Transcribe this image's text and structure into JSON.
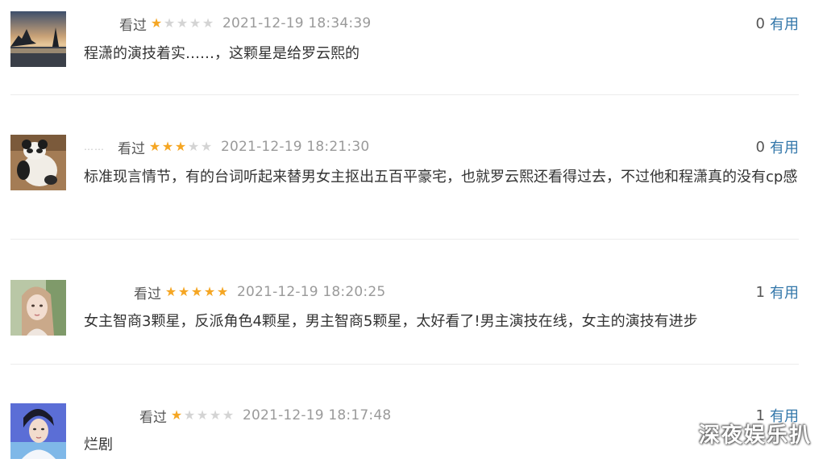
{
  "reviews": [
    {
      "username": "",
      "status": "看过",
      "rating": 1,
      "time": "2021-12-19 18:34:39",
      "useful_count": "0",
      "useful_label": "有用",
      "content": "程潇的演技着实……，这颗星是给罗云熙的",
      "avatar_icon": "sunset-lake-avatar"
    },
    {
      "username": "……",
      "status": "看过",
      "rating": 3,
      "time": "2021-12-19 18:21:30",
      "useful_count": "0",
      "useful_label": "有用",
      "content": "标准现言情节，有的台词听起来替男女主抠出五百平豪宅，也就罗云熙还看得过去，不过他和程潇真的没有cp感",
      "avatar_icon": "panda-avatar"
    },
    {
      "username": "",
      "status": "看过",
      "rating": 5,
      "time": "2021-12-19 18:20:25",
      "useful_count": "1",
      "useful_label": "有用",
      "content": "女主智商3颗星，反派角色4颗星，男主智商5颗星，太好看了!男主演技在线，女主的演技有进步",
      "avatar_icon": "girl-portrait-avatar"
    },
    {
      "username": "",
      "status": "看过",
      "rating": 1,
      "time": "2021-12-19 18:17:48",
      "useful_count": "1",
      "useful_label": "有用",
      "content": "烂剧",
      "avatar_icon": "boy-portrait-avatar"
    }
  ],
  "watermark": "深夜娱乐扒",
  "colors": {
    "star_on": "#f5a623",
    "star_off": "#d4d4d4",
    "link": "#3377aa",
    "divider": "#ececec"
  }
}
